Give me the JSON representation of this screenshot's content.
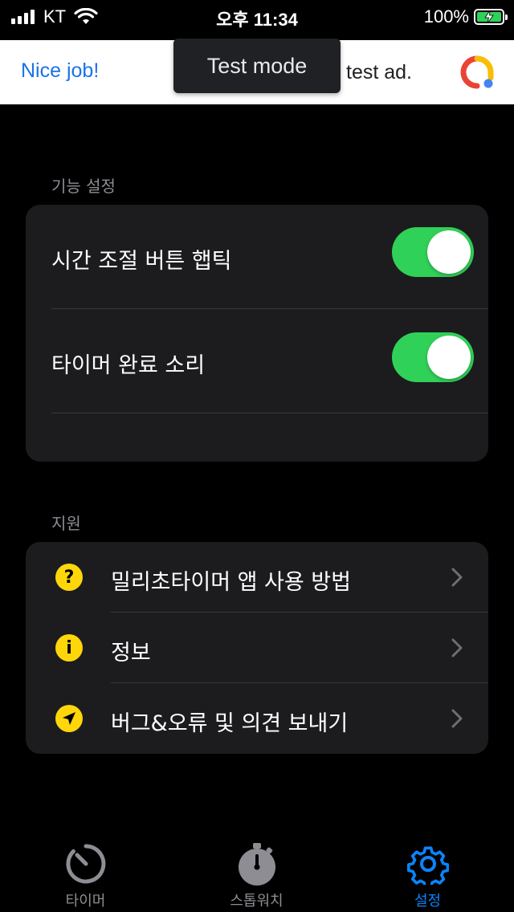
{
  "status_bar": {
    "carrier": "KT",
    "time": "오후 11:34",
    "battery": "100%"
  },
  "ad": {
    "headline": "Nice job!",
    "body": "test ad.",
    "toast": "Test mode"
  },
  "feature_settings": {
    "header": "기능 설정",
    "items": [
      {
        "label": "시간 조절 버튼 햅틱",
        "enabled": true
      },
      {
        "label": "타이머 완료 소리",
        "enabled": true
      }
    ]
  },
  "support": {
    "header": "지원",
    "items": [
      {
        "label": "밀리초타이머 앱 사용 방법",
        "icon": "question-icon"
      },
      {
        "label": "정보",
        "icon": "info-icon"
      },
      {
        "label": "버그&오류 및 의견 보내기",
        "icon": "paper-plane-icon"
      }
    ]
  },
  "tabs": [
    {
      "label": "타이머",
      "icon": "timer-icon",
      "active": false
    },
    {
      "label": "스톱워치",
      "icon": "stopwatch-icon",
      "active": false
    },
    {
      "label": "설정",
      "icon": "gear-icon",
      "active": true
    }
  ],
  "colors": {
    "toggle_on": "#30d158",
    "accent": "#0a84ff",
    "icon_yellow": "#ffd60a",
    "card_bg": "#1c1c1e"
  }
}
